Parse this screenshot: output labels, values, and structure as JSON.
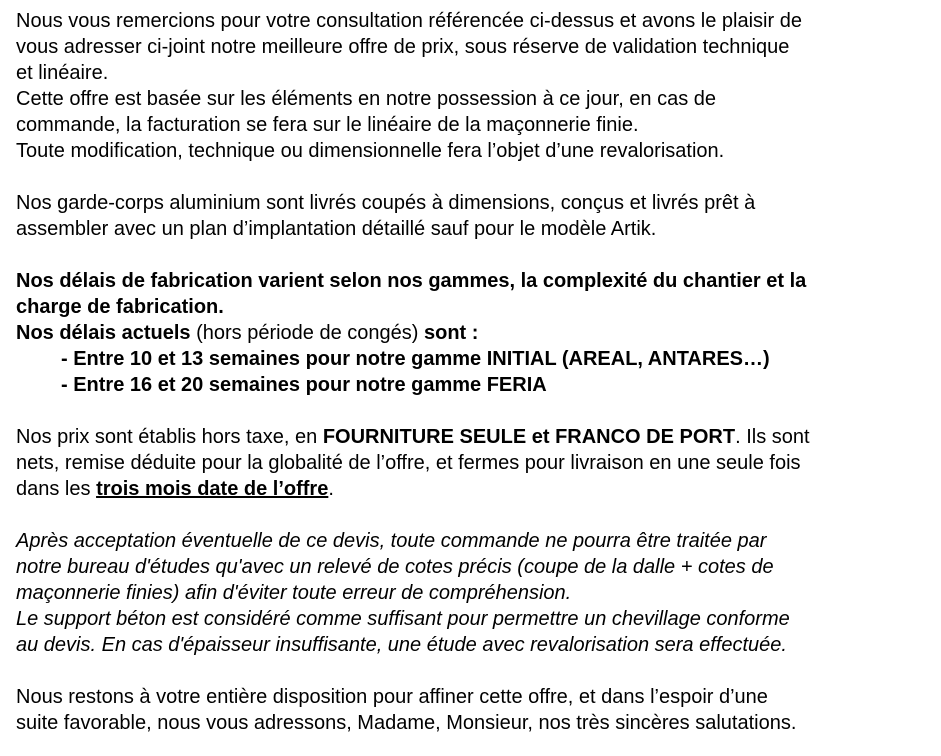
{
  "paragraph1": {
    "line1": "Nous vous remercions pour votre consultation référencée ci-dessus et avons le plaisir de",
    "line2": "vous adresser ci-joint notre meilleure offre de prix, sous réserve de validation technique",
    "line3": "et linéaire.",
    "line4": "Cette offre est basée sur les éléments en notre possession à ce jour, en cas de",
    "line5": "commande, la facturation se fera sur le linéaire de la maçonnerie finie.",
    "line6": "Toute modification, technique ou dimensionnelle fera l’objet d’une revalorisation."
  },
  "paragraph2": {
    "line1": "Nos garde-corps aluminium  sont livrés coupés à dimensions, conçus et livrés prêt à",
    "line2": "assembler avec un plan d’implantation détaillé sauf pour le modèle Artik."
  },
  "paragraph3": {
    "line1": "Nos délais de fabrication varient selon nos gammes, la complexité du chantier et la",
    "line2": "charge de fabrication.",
    "line3_bold_a": "Nos délais actuels",
    "line3_normal": " (hors période de congés) ",
    "line3_bold_b": "sont :",
    "item1": "- Entre 10 et 13 semaines pour notre gamme INITIAL (AREAL, ANTARES…)",
    "item2": "- Entre 16 et 20 semaines pour notre gamme FERIA"
  },
  "paragraph4": {
    "line1_a": "Nos prix sont établis hors taxe, en ",
    "line1_bold": "FOURNITURE SEULE et FRANCO DE PORT",
    "line1_b": ". Ils sont",
    "line2": "nets, remise déduite pour la globalité de l’offre, et fermes pour livraison en une seule fois",
    "line3_a": "dans les ",
    "line3_bold_underline": "trois mois date de l’offre",
    "line3_b": "."
  },
  "paragraph5": {
    "line1": "Après acceptation éventuelle de ce devis, toute commande ne pourra être traitée par",
    "line2": "notre bureau d'études qu'avec un relevé de cotes précis (coupe de la dalle + cotes de",
    "line3": "maçonnerie finies) afin d'éviter toute erreur de compréhension.",
    "line4": "Le support béton est considéré comme suffisant pour permettre un chevillage conforme",
    "line5": "au devis. En cas d'épaisseur insuffisante, une étude avec revalorisation sera effectuée."
  },
  "paragraph6": {
    "line1": "Nous restons à votre entière disposition pour affiner cette offre, et dans l’espoir d’une",
    "line2": "suite favorable, nous vous adressons, Madame, Monsieur, nos très sincères salutations."
  }
}
